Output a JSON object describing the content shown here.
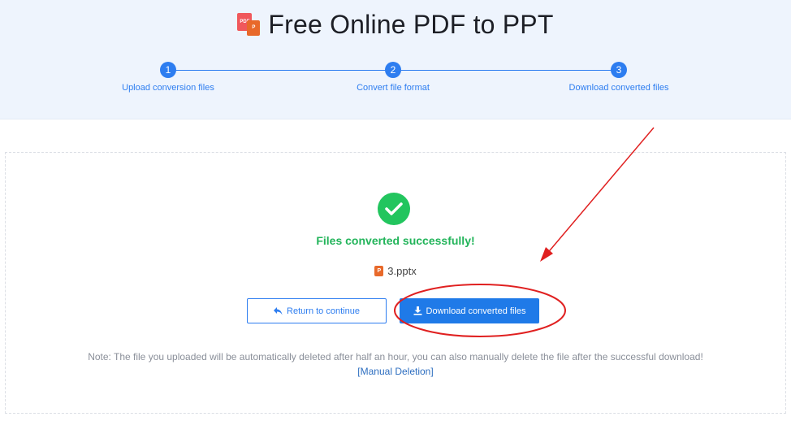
{
  "header": {
    "title": "Free Online PDF to PPT",
    "logo_pdf_text": "PDF",
    "logo_ppt_text": "P"
  },
  "steps": [
    {
      "number": "1",
      "label": "Upload conversion files"
    },
    {
      "number": "2",
      "label": "Convert file format"
    },
    {
      "number": "3",
      "label": "Download converted files"
    }
  ],
  "result": {
    "status": "Files converted successfully!",
    "file_name": "3.pptx",
    "file_icon_text": "P"
  },
  "buttons": {
    "return_label": "Return to continue",
    "download_label": "Download converted files"
  },
  "note": {
    "text": "Note: The file you uploaded will be automatically deleted after half an hour, you can also manually delete the file after the successful download!",
    "manual_link": "[Manual Deletion]"
  },
  "colors": {
    "accent": "#2d7df0",
    "success": "#22c55e",
    "annotation": "#e02020"
  },
  "icons": {
    "check": "check-circle-icon",
    "return": "return-arrow-icon",
    "download": "download-icon"
  }
}
